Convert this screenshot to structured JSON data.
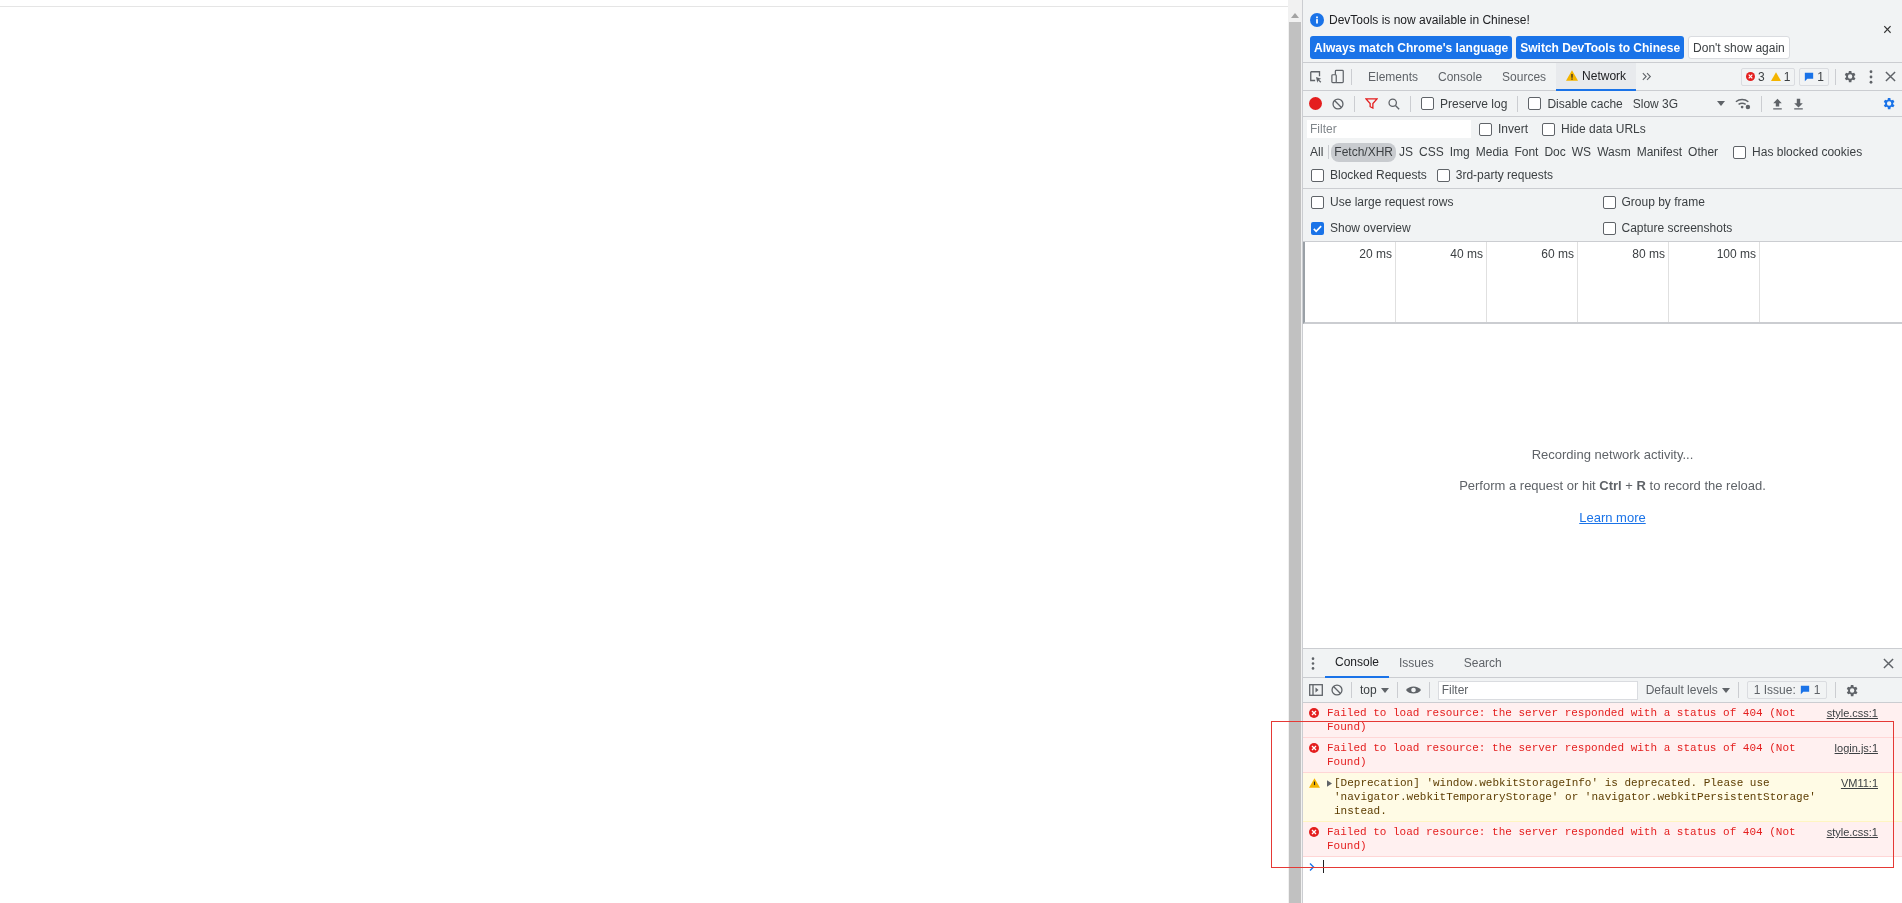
{
  "infobar": {
    "message": "DevTools is now available in Chinese!",
    "buttons": [
      {
        "label": "Always match Chrome's language",
        "kind": "primary"
      },
      {
        "label": "Switch DevTools to Chinese",
        "kind": "primary"
      },
      {
        "label": "Don't show again",
        "kind": "plain"
      }
    ],
    "close": "×"
  },
  "main_tabs": [
    {
      "label": "Elements",
      "selected": false,
      "warning": false
    },
    {
      "label": "Console",
      "selected": false,
      "warning": false
    },
    {
      "label": "Sources",
      "selected": false,
      "warning": false
    },
    {
      "label": "Network",
      "selected": true,
      "warning": true
    }
  ],
  "counters": {
    "errors": "3",
    "warnings": "1",
    "issues": "1"
  },
  "toolbar": {
    "recording": true,
    "preserve_log": {
      "label": "Preserve log",
      "checked": false
    },
    "disable_cache": {
      "label": "Disable cache",
      "checked": false
    },
    "throttling": "Slow 3G"
  },
  "filter": {
    "placeholder": "Filter",
    "options": [
      {
        "label": "Invert",
        "checked": false
      },
      {
        "label": "Hide data URLs",
        "checked": false
      }
    ]
  },
  "type_filters": [
    {
      "label": "All",
      "selected": false
    },
    {
      "label": "Fetch/XHR",
      "selected": true
    },
    {
      "label": "JS",
      "selected": false
    },
    {
      "label": "CSS",
      "selected": false
    },
    {
      "label": "Img",
      "selected": false
    },
    {
      "label": "Media",
      "selected": false
    },
    {
      "label": "Font",
      "selected": false
    },
    {
      "label": "Doc",
      "selected": false
    },
    {
      "label": "WS",
      "selected": false
    },
    {
      "label": "Wasm",
      "selected": false
    },
    {
      "label": "Manifest",
      "selected": false
    },
    {
      "label": "Other",
      "selected": false
    }
  ],
  "has_blocked_cookies": {
    "label": "Has blocked cookies",
    "checked": false
  },
  "request_options": [
    {
      "label": "Blocked Requests",
      "checked": false
    },
    {
      "label": "3rd-party requests",
      "checked": false
    }
  ],
  "settings": [
    {
      "label": "Use large request rows",
      "checked": false
    },
    {
      "label": "Group by frame",
      "checked": false
    },
    {
      "label": "Show overview",
      "checked": true
    },
    {
      "label": "Capture screenshots",
      "checked": false
    }
  ],
  "timeline_ticks": [
    "20 ms",
    "40 ms",
    "60 ms",
    "80 ms",
    "100 ms"
  ],
  "empty_state": {
    "title": "Recording network activity...",
    "hint": "Perform a request or hit **Ctrl** + **R** to record the reload.",
    "link": "Learn more"
  },
  "drawer": {
    "tabs": [
      {
        "label": "Console",
        "selected": true
      },
      {
        "label": "Issues",
        "selected": false
      },
      {
        "label": "Search",
        "selected": false
      }
    ],
    "context": "top",
    "filter_placeholder": "Filter",
    "levels": "Default levels",
    "issues_label": "1 Issue:",
    "issues_count": "1"
  },
  "messages": [
    {
      "kind": "error",
      "text": "Failed to load resource: the server responded with a status of 404 (Not Found)",
      "source": "style.css:1"
    },
    {
      "kind": "error",
      "text": "Failed to load resource: the server responded with a status of 404 (Not Found)",
      "source": "login.js:1"
    },
    {
      "kind": "warning",
      "text": "[Deprecation] 'window.webkitStorageInfo' is deprecated. Please use 'navigator.webkitTemporaryStorage' or 'navigator.webkitPersistentStorage' instead.",
      "source": "VM11:1"
    },
    {
      "kind": "error",
      "text": "Failed to load resource: the server responded with a status of 404 (Not Found)",
      "source": "style.css:1"
    }
  ]
}
